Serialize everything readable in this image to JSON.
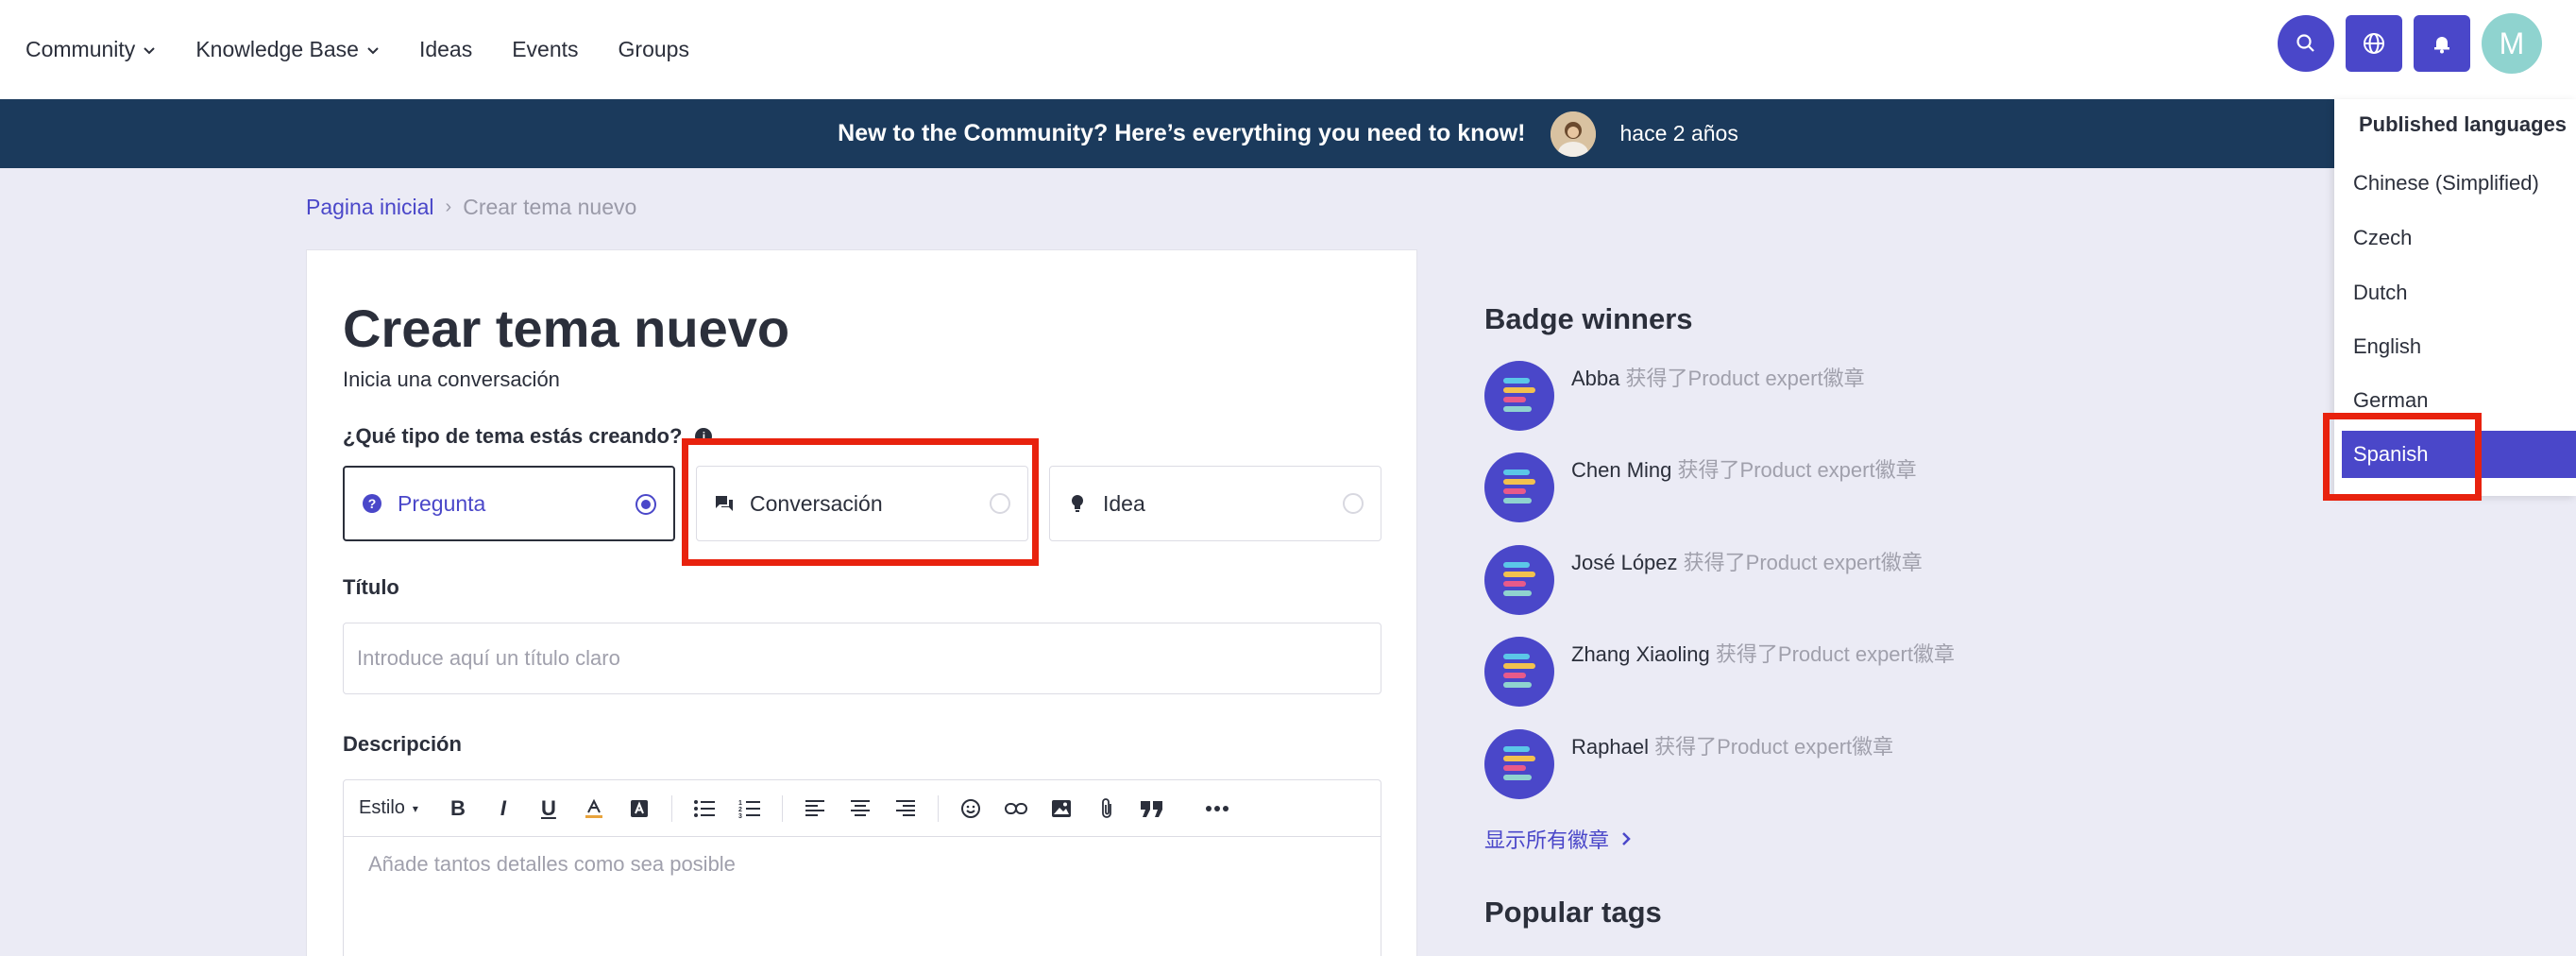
{
  "nav": {
    "items": [
      {
        "label": "Community",
        "has_menu": true
      },
      {
        "label": "Knowledge Base",
        "has_menu": true
      },
      {
        "label": "Ideas",
        "has_menu": false
      },
      {
        "label": "Events",
        "has_menu": false
      },
      {
        "label": "Groups",
        "has_menu": false
      }
    ],
    "avatar_initial": "M",
    "icons": [
      "search-icon",
      "globe-icon",
      "bell-icon"
    ]
  },
  "banner": {
    "text": "New to the Community? Here’s everything you need to know!",
    "time": "hace 2 años"
  },
  "breadcrumb": {
    "home": "Pagina inicial",
    "separator": "›",
    "current": "Crear tema nuevo"
  },
  "form": {
    "title": "Crear tema nuevo",
    "subtitle": "Inicia una conversación",
    "type_question": "¿Qué tipo de tema estás creando?",
    "types": [
      {
        "label": "Pregunta",
        "selected": true,
        "icon": "question-icon"
      },
      {
        "label": "Conversación",
        "selected": false,
        "icon": "chat-icon"
      },
      {
        "label": "Idea",
        "selected": false,
        "icon": "lightbulb-icon"
      }
    ],
    "title_label": "Título",
    "title_placeholder": "Introduce aquí un título claro",
    "description_label": "Descripción",
    "editor_style": "Estilo",
    "editor_placeholder": "Añade tantos detalles como sea posible"
  },
  "sidebar": {
    "badge_title": "Badge winners",
    "badges": [
      {
        "name": "Abba",
        "achievement": "获得了Product expert徽章"
      },
      {
        "name": "Chen Ming",
        "achievement": "获得了Product expert徽章"
      },
      {
        "name": "José López",
        "achievement": "获得了Product expert徽章"
      },
      {
        "name": "Zhang Xiaoling",
        "achievement": "获得了Product expert徽章"
      },
      {
        "name": "Raphael",
        "achievement": "获得了Product expert徽章"
      }
    ],
    "show_all": "显示所有徽章",
    "tags_title": "Popular tags"
  },
  "language_menu": {
    "header": "Published languages",
    "items": [
      "Chinese (Simplified)",
      "Czech",
      "Dutch",
      "English",
      "German",
      "Spanish"
    ],
    "active": "Spanish"
  },
  "colors": {
    "accent": "#4a47c9",
    "banner": "#1b3a5c",
    "highlight": "#e8220e",
    "page_bg": "#ebebf5"
  }
}
